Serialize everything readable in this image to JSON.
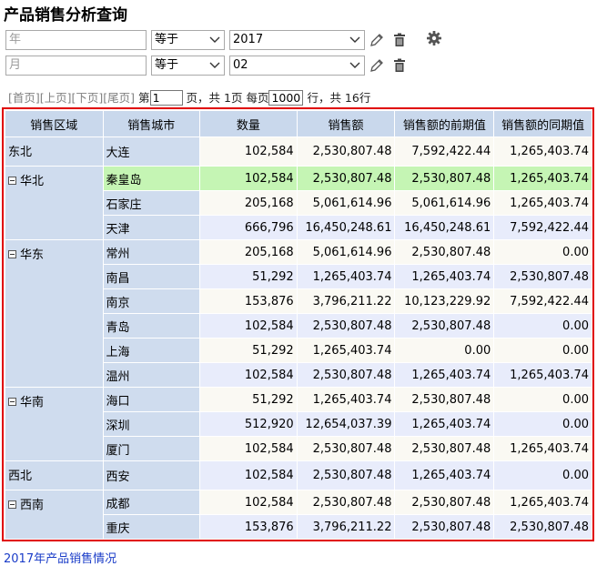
{
  "title": "产品销售分析查询",
  "filters": [
    {
      "field_placeholder": "年",
      "operator": "等于",
      "value": "2017"
    },
    {
      "field_placeholder": "月",
      "operator": "等于",
      "value": "02"
    }
  ],
  "icons": {
    "edit": "pencil-icon",
    "delete": "trash-icon",
    "settings": "gear-icon",
    "collapse": "minus-box-icon",
    "dropdown": "chevron-down-icon"
  },
  "pager": {
    "first": "[首页]",
    "prev": "[上页]",
    "next": "[下页]",
    "last": "[尾页]",
    "page_prefix": "第",
    "page_value": "1",
    "page_suffix": "页，共 1页 每页",
    "per_page": "1000",
    "rows_suffix": "行，共 16行"
  },
  "table": {
    "headers": [
      "销售区域",
      "销售城市",
      "数量",
      "销售额",
      "销售额的前期值",
      "销售额的同期值"
    ],
    "groups": [
      {
        "region": "东北",
        "collapsible": false,
        "rows": [
          {
            "city": "大连",
            "qty": "102,584",
            "sales": "2,530,807.48",
            "prev": "7,592,422.44",
            "same": "1,265,403.74"
          }
        ]
      },
      {
        "region": "华北",
        "collapsible": true,
        "rows": [
          {
            "city": "秦皇岛",
            "qty": "102,584",
            "sales": "2,530,807.48",
            "prev": "2,530,807.48",
            "same": "1,265,403.74",
            "highlight": true
          },
          {
            "city": "石家庄",
            "qty": "205,168",
            "sales": "5,061,614.96",
            "prev": "5,061,614.96",
            "same": "1,265,403.74"
          },
          {
            "city": "天津",
            "qty": "666,796",
            "sales": "16,450,248.61",
            "prev": "16,450,248.61",
            "same": "7,592,422.44"
          }
        ]
      },
      {
        "region": "华东",
        "collapsible": true,
        "rows": [
          {
            "city": "常州",
            "qty": "205,168",
            "sales": "5,061,614.96",
            "prev": "2,530,807.48",
            "same": "0.00"
          },
          {
            "city": "南昌",
            "qty": "51,292",
            "sales": "1,265,403.74",
            "prev": "1,265,403.74",
            "same": "2,530,807.48"
          },
          {
            "city": "南京",
            "qty": "153,876",
            "sales": "3,796,211.22",
            "prev": "10,123,229.92",
            "same": "7,592,422.44"
          },
          {
            "city": "青岛",
            "qty": "102,584",
            "sales": "2,530,807.48",
            "prev": "2,530,807.48",
            "same": "0.00"
          },
          {
            "city": "上海",
            "qty": "51,292",
            "sales": "1,265,403.74",
            "prev": "0.00",
            "same": "0.00"
          },
          {
            "city": "温州",
            "qty": "102,584",
            "sales": "2,530,807.48",
            "prev": "1,265,403.74",
            "same": "1,265,403.74"
          }
        ]
      },
      {
        "region": "华南",
        "collapsible": true,
        "rows": [
          {
            "city": "海口",
            "qty": "51,292",
            "sales": "1,265,403.74",
            "prev": "2,530,807.48",
            "same": "0.00"
          },
          {
            "city": "深圳",
            "qty": "512,920",
            "sales": "12,654,037.39",
            "prev": "1,265,403.74",
            "same": "0.00"
          },
          {
            "city": "厦门",
            "qty": "102,584",
            "sales": "2,530,807.48",
            "prev": "2,530,807.48",
            "same": "1,265,403.74"
          }
        ]
      },
      {
        "region": "西北",
        "collapsible": false,
        "rows": [
          {
            "city": "西安",
            "qty": "102,584",
            "sales": "2,530,807.48",
            "prev": "1,265,403.74",
            "same": "0.00"
          }
        ]
      },
      {
        "region": "西南",
        "collapsible": true,
        "rows": [
          {
            "city": "成都",
            "qty": "102,584",
            "sales": "2,530,807.48",
            "prev": "2,530,807.48",
            "same": "1,265,403.74"
          },
          {
            "city": "重庆",
            "qty": "153,876",
            "sales": "3,796,211.22",
            "prev": "2,530,807.48",
            "same": "2,530,807.48"
          }
        ]
      }
    ]
  },
  "footer_link": "2017年产品销售情况"
}
